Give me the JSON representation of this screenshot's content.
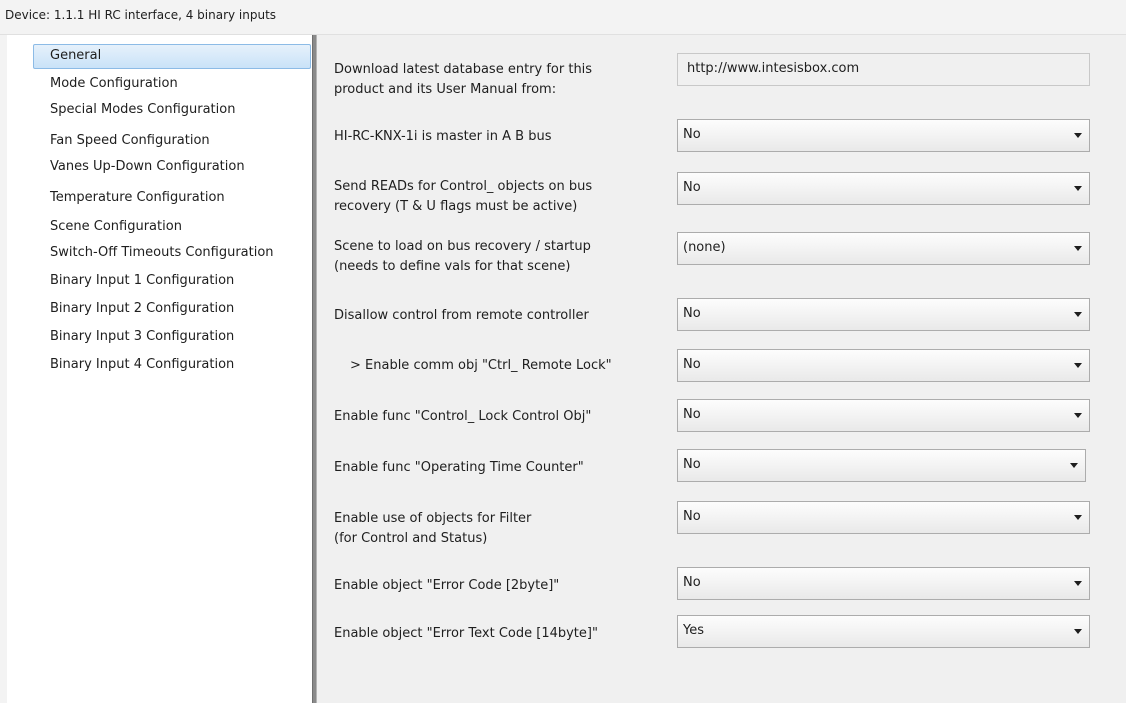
{
  "device_title": "Device: 1.1.1  HI RC interface, 4 binary inputs",
  "sidebar": {
    "items": [
      {
        "label": "General",
        "selected": true
      },
      {
        "label": "Mode Configuration"
      },
      {
        "label": "Special Modes Configuration"
      },
      {
        "label": "Fan Speed Configuration"
      },
      {
        "label": "Vanes Up-Down Configuration"
      },
      {
        "label": "Temperature Configuration"
      },
      {
        "label": "Scene Configuration"
      },
      {
        "label": "Switch-Off Timeouts Configuration"
      },
      {
        "label": "Binary Input 1 Configuration"
      },
      {
        "label": "Binary Input 2 Configuration"
      },
      {
        "label": "Binary Input 3 Configuration"
      },
      {
        "label": "Binary Input 4 Configuration"
      }
    ]
  },
  "params": {
    "download": {
      "label_line1": "Download latest database entry for this",
      "label_line2": "product and its User Manual from:",
      "value": "http://www.intesisbox.com"
    },
    "master": {
      "label": "HI-RC-KNX-1i is master in A B bus",
      "value": "No"
    },
    "send_reads": {
      "label_line1": "Send READs for Control_ objects on bus",
      "label_line2": "recovery (T & U flags must be active)",
      "value": "No"
    },
    "scene_load": {
      "label_line1": "Scene to load on bus recovery / startup",
      "label_line2": "(needs to define vals for that scene)",
      "value": "(none)"
    },
    "disallow": {
      "label": "Disallow control from remote controller",
      "value": "No"
    },
    "remote_lock": {
      "label": "> Enable comm obj \"Ctrl_ Remote Lock\"",
      "value": "No"
    },
    "lock_control": {
      "label": "Enable func \"Control_ Lock Control Obj\"",
      "value": "No"
    },
    "op_time": {
      "label": "Enable func \"Operating Time Counter\"",
      "value": "No"
    },
    "filter": {
      "label_line1": "Enable use of objects for Filter",
      "label_line2": "(for Control and Status)",
      "value": "No"
    },
    "error_code": {
      "label": "Enable object \"Error Code [2byte]\"",
      "value": "No"
    },
    "error_text": {
      "label": "Enable object \"Error Text Code [14byte]\"",
      "value": "Yes"
    }
  }
}
